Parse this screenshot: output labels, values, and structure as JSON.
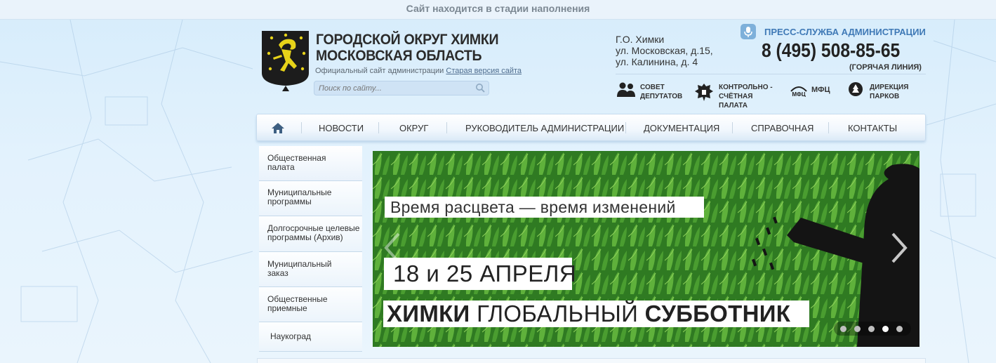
{
  "topbar": {
    "notice": "Сайт находится в стадии наполнения"
  },
  "header": {
    "title_line1": "ГОРОДСКОЙ ОКРУГ ХИМКИ",
    "title_line2": "МОСКОВСКАЯ ОБЛАСТЬ",
    "subtitle": "Официальный сайт администрации",
    "old_version_link": "Старая версия сайта",
    "search_placeholder": "Поиск по сайту...",
    "address": [
      "Г.О. Химки",
      "ул. Московская, д.15,",
      "ул. Калинина, д. 4"
    ],
    "press_label": "ПРЕСС-СЛУЖБА АДМИНИСТРАЦИИ",
    "phone": "8 (495) 508-85-65",
    "hotline": "(ГОРЯЧАЯ ЛИНИЯ)",
    "quick_links": [
      {
        "line1": "СОВЕТ",
        "line2": "ДЕПУТАТОВ",
        "line3": "",
        "icon": "people-icon"
      },
      {
        "line1": "КОНТРОЛЬНО -",
        "line2": "СЧЁТНАЯ",
        "line3": "ПАЛАТА",
        "icon": "coat-of-arms-icon"
      },
      {
        "line1": "МФЦ",
        "line2": "",
        "line3": "",
        "icon": "mfc-icon"
      },
      {
        "line1": "ДИРЕКЦИЯ",
        "line2": "ПАРКОВ",
        "line3": "",
        "icon": "park-icon"
      }
    ]
  },
  "nav": {
    "items": [
      "НОВОСТИ",
      "ОКРУГ",
      "РУКОВОДИТЕЛЬ АДМИНИСТРАЦИИ",
      "ДОКУМЕНТАЦИЯ",
      "СПРАВОЧНАЯ",
      "КОНТАКТЫ"
    ]
  },
  "sidebar": {
    "items": [
      {
        "line1": "Общественная",
        "line2": "палата"
      },
      {
        "line1": "Муниципальные",
        "line2": "программы"
      },
      {
        "line1": "Долгосрочные целевые",
        "line2": "программы (Архив)"
      },
      {
        "line1": "Муниципальный",
        "line2": "заказ"
      },
      {
        "line1": "Общественные",
        "line2": "приемные"
      },
      {
        "line1": "Наукоград",
        "line2": ""
      }
    ]
  },
  "banner": {
    "slogan": "Время расцвета — время изменений",
    "date": "18 и 25 АПРЕЛЯ",
    "title_bold1": "ХИМКИ",
    "title_light": "ГЛОБАЛЬНЫЙ",
    "title_bold2": "СУББОТНИК",
    "slides_total": 5,
    "active_slide": 4,
    "colors": {
      "grass": "#3c8b2a",
      "silhouette": "#111111"
    }
  }
}
